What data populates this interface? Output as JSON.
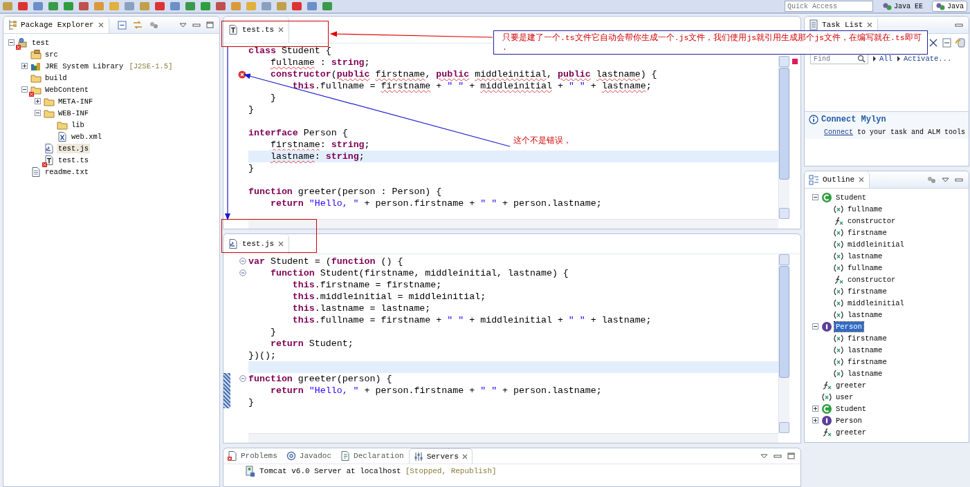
{
  "toolbar": {
    "quick_access": {
      "placeholder": "Quick Access"
    },
    "perspectives": [
      {
        "label": "Java EE",
        "selected": false
      },
      {
        "label": "Java",
        "selected": true
      }
    ]
  },
  "package_explorer": {
    "title": "Package Explorer",
    "tree": [
      {
        "label": "test",
        "kind": "project",
        "selected": false,
        "error": true,
        "expanded": true,
        "children": [
          {
            "label": "src",
            "kind": "source_folder",
            "selected": false,
            "error": false
          },
          {
            "label": "JRE System Library",
            "decoration": "[J2SE-1.5]",
            "kind": "library",
            "selected": false,
            "error": false,
            "expanded": false
          },
          {
            "label": "build",
            "kind": "folder",
            "selected": false,
            "error": false
          },
          {
            "label": "WebContent",
            "kind": "folder",
            "selected": false,
            "error": true,
            "expanded": true,
            "children": [
              {
                "label": "META-INF",
                "kind": "folder",
                "selected": false,
                "error": false,
                "expanded": false
              },
              {
                "label": "WEB-INF",
                "kind": "folder",
                "selected": false,
                "error": false,
                "expanded": true,
                "children": [
                  {
                    "label": "lib",
                    "kind": "folder",
                    "selected": false,
                    "error": false
                  },
                  {
                    "label": "web.xml",
                    "kind": "xml_file",
                    "selected": false,
                    "error": false
                  }
                ]
              },
              {
                "label": "test.js",
                "kind": "script_file",
                "selected": true,
                "error": false
              },
              {
                "label": "test.ts",
                "kind": "typescript_file",
                "selected": false,
                "error": true
              }
            ]
          },
          {
            "label": "readme.txt",
            "kind": "text_file",
            "selected": false,
            "error": false
          }
        ]
      }
    ]
  },
  "editors": [
    {
      "tab": {
        "label": "test.ts",
        "kind": "typescript_file"
      },
      "lines": [
        {
          "kind": "code",
          "current": false,
          "error": false,
          "tokens": [
            {
              "kind": "keyword",
              "text": "class"
            },
            {
              "kind": "plain",
              "text": " Student {"
            }
          ]
        },
        {
          "kind": "code",
          "current": false,
          "error": false,
          "tokens": [
            {
              "kind": "error",
              "text": "    fullname"
            },
            {
              "kind": "plain",
              "text": " : "
            },
            {
              "kind": "keyword",
              "text": "string"
            },
            {
              "kind": "plain",
              "text": ";"
            }
          ]
        },
        {
          "kind": "code",
          "current": false,
          "error": true,
          "tokens": [
            {
              "kind": "keyword",
              "text": "    constructor"
            },
            {
              "kind": "plain",
              "text": "("
            },
            {
              "kind": "keyword_error",
              "text": "public"
            },
            {
              "kind": "error",
              "text": " firstname"
            },
            {
              "kind": "plain",
              "text": ", "
            },
            {
              "kind": "keyword_error",
              "text": "public"
            },
            {
              "kind": "error",
              "text": " middleinitial"
            },
            {
              "kind": "plain",
              "text": ", "
            },
            {
              "kind": "keyword_error",
              "text": "public"
            },
            {
              "kind": "error",
              "text": " lastname"
            },
            {
              "kind": "plain",
              "text": ") {"
            }
          ]
        },
        {
          "kind": "code",
          "current": false,
          "error": false,
          "tokens": [
            {
              "kind": "keyword",
              "text": "        this"
            },
            {
              "kind": "plain",
              "text": ".fullname = "
            },
            {
              "kind": "error",
              "text": "firstname"
            },
            {
              "kind": "plain",
              "text": " + "
            },
            {
              "kind": "string",
              "text": "\" \""
            },
            {
              "kind": "plain",
              "text": " + "
            },
            {
              "kind": "error",
              "text": "middleinitial"
            },
            {
              "kind": "plain",
              "text": " + "
            },
            {
              "kind": "string",
              "text": "\" \""
            },
            {
              "kind": "plain",
              "text": " + "
            },
            {
              "kind": "error",
              "text": "lastname"
            },
            {
              "kind": "plain",
              "text": ";"
            }
          ]
        },
        {
          "kind": "code",
          "current": false,
          "error": false,
          "tokens": [
            {
              "kind": "plain",
              "text": "    }"
            }
          ]
        },
        {
          "kind": "code",
          "current": false,
          "error": false,
          "tokens": [
            {
              "kind": "plain",
              "text": "}"
            }
          ]
        },
        {
          "kind": "blank",
          "current": false,
          "error": false
        },
        {
          "kind": "code",
          "current": false,
          "error": false,
          "tokens": [
            {
              "kind": "keyword",
              "text": "interface"
            },
            {
              "kind": "plain",
              "text": " Person {"
            }
          ]
        },
        {
          "kind": "code",
          "current": false,
          "error": false,
          "tokens": [
            {
              "kind": "error",
              "text": "    firstname"
            },
            {
              "kind": "plain",
              "text": ": "
            },
            {
              "kind": "keyword",
              "text": "string"
            },
            {
              "kind": "plain",
              "text": ";"
            }
          ]
        },
        {
          "kind": "code",
          "current": true,
          "error": false,
          "tokens": [
            {
              "kind": "error",
              "text": "    lastname"
            },
            {
              "kind": "plain",
              "text": ": "
            },
            {
              "kind": "keyword",
              "text": "string"
            },
            {
              "kind": "plain",
              "text": ";"
            }
          ]
        },
        {
          "kind": "code",
          "current": false,
          "error": false,
          "tokens": [
            {
              "kind": "plain",
              "text": "}"
            }
          ]
        },
        {
          "kind": "blank",
          "current": false,
          "error": false
        },
        {
          "kind": "code",
          "current": false,
          "error": false,
          "tokens": [
            {
              "kind": "keyword",
              "text": "function"
            },
            {
              "kind": "plain",
              "text": " greeter(person : Person) {"
            }
          ]
        },
        {
          "kind": "code",
          "current": false,
          "error": false,
          "tokens": [
            {
              "kind": "keyword",
              "text": "    return "
            },
            {
              "kind": "string",
              "text": "\"Hello, \""
            },
            {
              "kind": "plain",
              "text": " + person.firstname + "
            },
            {
              "kind": "string",
              "text": "\" \""
            },
            {
              "kind": "plain",
              "text": " + person.lastname;"
            }
          ]
        }
      ]
    },
    {
      "tab": {
        "label": "test.js",
        "kind": "script_file"
      },
      "lines": [
        {
          "kind": "code",
          "current": false,
          "changed": false,
          "foldable": true,
          "tokens": [
            {
              "kind": "keyword",
              "text": "var"
            },
            {
              "kind": "plain",
              "text": " Student = ("
            },
            {
              "kind": "keyword",
              "text": "function"
            },
            {
              "kind": "plain",
              "text": " () {"
            }
          ]
        },
        {
          "kind": "code",
          "current": false,
          "changed": false,
          "foldable": true,
          "tokens": [
            {
              "kind": "keyword",
              "text": "    function"
            },
            {
              "kind": "plain",
              "text": " Student(firstname, middleinitial, lastname) {"
            }
          ]
        },
        {
          "kind": "code",
          "current": false,
          "changed": false,
          "foldable": false,
          "tokens": [
            {
              "kind": "keyword",
              "text": "        this"
            },
            {
              "kind": "plain",
              "text": ".firstname = firstname;"
            }
          ]
        },
        {
          "kind": "code",
          "current": false,
          "changed": false,
          "foldable": false,
          "tokens": [
            {
              "kind": "keyword",
              "text": "        this"
            },
            {
              "kind": "plain",
              "text": ".middleinitial = middleinitial;"
            }
          ]
        },
        {
          "kind": "code",
          "current": false,
          "changed": false,
          "foldable": false,
          "tokens": [
            {
              "kind": "keyword",
              "text": "        this"
            },
            {
              "kind": "plain",
              "text": ".lastname = lastname;"
            }
          ]
        },
        {
          "kind": "code",
          "current": false,
          "changed": false,
          "foldable": false,
          "tokens": [
            {
              "kind": "keyword",
              "text": "        this"
            },
            {
              "kind": "plain",
              "text": ".fullname = firstname + "
            },
            {
              "kind": "string",
              "text": "\" \""
            },
            {
              "kind": "plain",
              "text": " + middleinitial + "
            },
            {
              "kind": "string",
              "text": "\" \""
            },
            {
              "kind": "plain",
              "text": " + lastname;"
            }
          ]
        },
        {
          "kind": "code",
          "current": false,
          "changed": false,
          "foldable": false,
          "tokens": [
            {
              "kind": "plain",
              "text": "    }"
            }
          ]
        },
        {
          "kind": "code",
          "current": false,
          "changed": false,
          "foldable": false,
          "tokens": [
            {
              "kind": "keyword",
              "text": "    return"
            },
            {
              "kind": "plain",
              "text": " Student;"
            }
          ]
        },
        {
          "kind": "code",
          "current": false,
          "changed": false,
          "foldable": false,
          "tokens": [
            {
              "kind": "plain",
              "text": "})();"
            }
          ]
        },
        {
          "kind": "blank",
          "current": true,
          "changed": false,
          "foldable": false
        },
        {
          "kind": "code",
          "current": false,
          "changed": true,
          "foldable": true,
          "tokens": [
            {
              "kind": "keyword",
              "text": "function"
            },
            {
              "kind": "plain",
              "text": " greeter(person) {"
            }
          ]
        },
        {
          "kind": "code",
          "current": false,
          "changed": true,
          "foldable": false,
          "tokens": [
            {
              "kind": "keyword",
              "text": "    return "
            },
            {
              "kind": "string",
              "text": "\"Hello, \""
            },
            {
              "kind": "plain",
              "text": " + person.firstname + "
            },
            {
              "kind": "string",
              "text": "\" \""
            },
            {
              "kind": "plain",
              "text": " + person.lastname;"
            }
          ]
        },
        {
          "kind": "code",
          "current": false,
          "changed": true,
          "foldable": false,
          "tokens": [
            {
              "kind": "plain",
              "text": "}"
            }
          ]
        }
      ]
    }
  ],
  "task_list": {
    "title": "Task List",
    "find": {
      "placeholder": "Find"
    },
    "filters": [
      "All",
      "Activate..."
    ],
    "connect": {
      "title": "Connect Mylyn",
      "link": "Connect",
      "text": " to your task and ALM tools"
    }
  },
  "outline": {
    "title": "Outline",
    "tree": [
      {
        "label": "Student",
        "kind": "class",
        "selected": false,
        "expanded": true,
        "children": [
          {
            "label": "fullname",
            "kind": "variable",
            "selected": false
          },
          {
            "label": "constructor",
            "kind": "function",
            "selected": false
          },
          {
            "label": "firstname",
            "kind": "variable",
            "selected": false
          },
          {
            "label": "middleinitial",
            "kind": "variable",
            "selected": false
          },
          {
            "label": "lastname",
            "kind": "variable",
            "selected": false
          },
          {
            "label": "fullname",
            "kind": "variable",
            "selected": false
          },
          {
            "label": "constructor",
            "kind": "function",
            "selected": false
          },
          {
            "label": "firstname",
            "kind": "variable",
            "selected": false
          },
          {
            "label": "middleinitial",
            "kind": "variable",
            "selected": false
          },
          {
            "label": "lastname",
            "kind": "variable",
            "selected": false
          }
        ]
      },
      {
        "label": "Person",
        "kind": "interface",
        "selected": true,
        "expanded": true,
        "children": [
          {
            "label": "firstname",
            "kind": "variable",
            "selected": false
          },
          {
            "label": "lastname",
            "kind": "variable",
            "selected": false
          },
          {
            "label": "firstname",
            "kind": "variable",
            "selected": false
          },
          {
            "label": "lastname",
            "kind": "variable",
            "selected": false
          }
        ]
      },
      {
        "label": "greeter",
        "kind": "function",
        "selected": false
      },
      {
        "label": "user",
        "kind": "variable",
        "selected": false
      },
      {
        "label": "Student",
        "kind": "class",
        "selected": false,
        "expanded": false
      },
      {
        "label": "Person",
        "kind": "interface",
        "selected": false,
        "expanded": false
      },
      {
        "label": "greeter",
        "kind": "function",
        "selected": false
      }
    ]
  },
  "bottom_panel": {
    "tabs": [
      {
        "label": "Problems",
        "kind": "problems",
        "selected": false
      },
      {
        "label": "Javadoc",
        "kind": "javadoc",
        "selected": false
      },
      {
        "label": "Declaration",
        "kind": "declaration",
        "selected": false
      },
      {
        "label": "Servers",
        "kind": "servers",
        "selected": true
      }
    ],
    "servers": [
      {
        "name": "Tomcat v6.0 Server at localhost",
        "status": "[Stopped, Republish]"
      }
    ]
  },
  "annotations": [
    {
      "kind": "callout",
      "lines": [
        "只要是建了一个.ts文件它自动会帮你生成一个.js文件，我们使用js就引用生成那个js文件，在编写就在.ts即可",
        "."
      ]
    },
    {
      "kind": "note",
      "text": "这个不是错误，"
    }
  ]
}
